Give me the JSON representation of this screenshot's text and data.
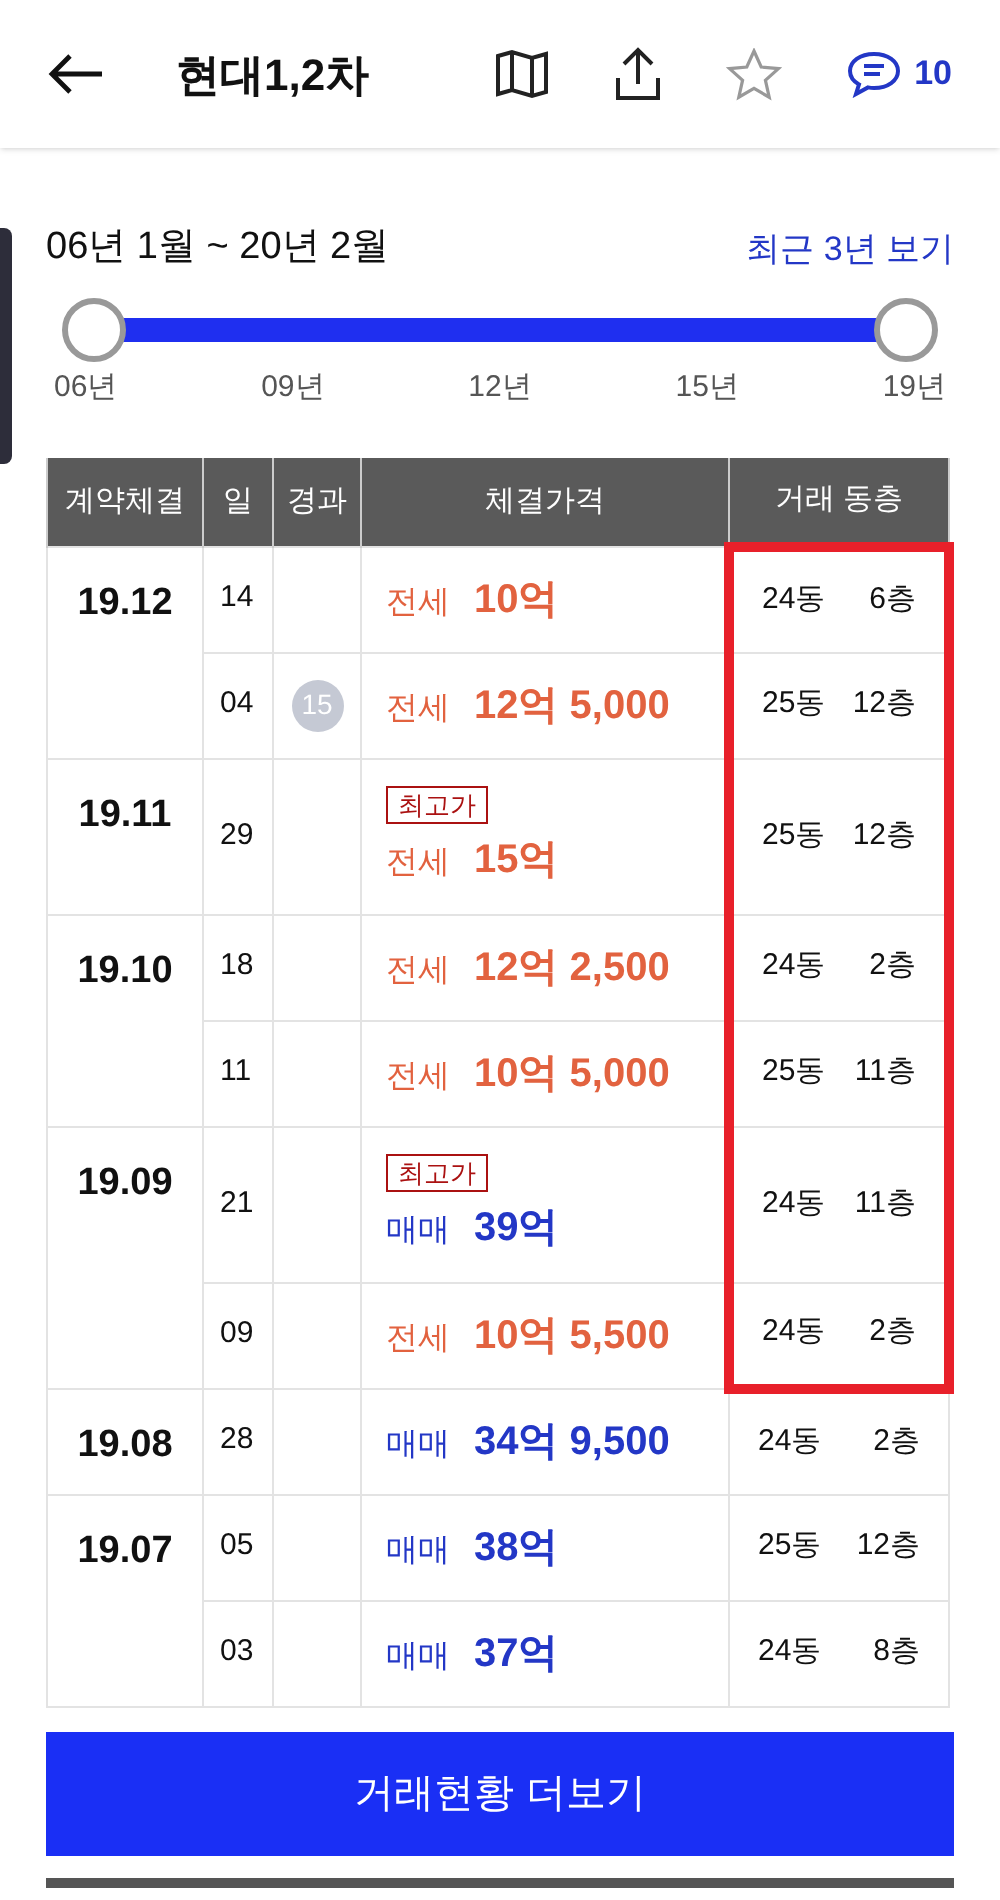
{
  "header": {
    "title": "현대1,2차",
    "favorited": false,
    "comment_count": "10"
  },
  "period": {
    "range": "06년 1월 ~ 20년 2월",
    "recent_link": "최근 3년 보기"
  },
  "slider": {
    "level": 1,
    "ticks": [
      "06년",
      "09년",
      "12년",
      "15년",
      "19년"
    ]
  },
  "table": {
    "columns": [
      "계약체결",
      "일",
      "경과",
      "체결가격",
      "거래 동층"
    ],
    "groups": [
      {
        "month": "19.12",
        "rows": [
          {
            "day": "14",
            "kind": "jeonse",
            "type": "전세",
            "price": "10억",
            "dong": "24동",
            "floor": "6층",
            "highlighted": true
          },
          {
            "day": "04",
            "elapsed": "15",
            "kind": "jeonse",
            "type": "전세",
            "price": "12억 5,000",
            "dong": "25동",
            "floor": "12층",
            "highlighted": true
          }
        ]
      },
      {
        "month": "19.11",
        "rows": [
          {
            "day": "29",
            "kind": "jeonse",
            "type": "전세",
            "price": "15억",
            "dong": "25동",
            "floor": "12층",
            "tag": "최고가",
            "highlighted": true
          }
        ]
      },
      {
        "month": "19.10",
        "rows": [
          {
            "day": "18",
            "kind": "jeonse",
            "type": "전세",
            "price": "12억 2,500",
            "dong": "24동",
            "floor": "2층",
            "highlighted": true
          },
          {
            "day": "11",
            "kind": "jeonse",
            "type": "전세",
            "price": "10억 5,000",
            "dong": "25동",
            "floor": "11층",
            "highlighted": true
          }
        ]
      },
      {
        "month": "19.09",
        "rows": [
          {
            "day": "21",
            "kind": "sale",
            "type": "매매",
            "price": "39억",
            "dong": "24동",
            "floor": "11층",
            "tag": "최고가",
            "highlighted": true
          },
          {
            "day": "09",
            "kind": "jeonse",
            "type": "전세",
            "price": "10억 5,500",
            "dong": "24동",
            "floor": "2층",
            "highlighted": true
          }
        ]
      },
      {
        "month": "19.08",
        "rows": [
          {
            "day": "28",
            "kind": "sale",
            "type": "매매",
            "price": "34억 9,500",
            "dong": "24동",
            "floor": "2층",
            "highlighted": false
          }
        ]
      },
      {
        "month": "19.07",
        "rows": [
          {
            "day": "05",
            "kind": "sale",
            "type": "매매",
            "price": "38억",
            "dong": "25동",
            "floor": "12층",
            "highlighted": false
          },
          {
            "day": "03",
            "kind": "sale",
            "type": "매매",
            "price": "37억",
            "dong": "24동",
            "floor": "8층",
            "highlighted": false
          }
        ]
      }
    ]
  },
  "more_button": "거래현황 더보기"
}
